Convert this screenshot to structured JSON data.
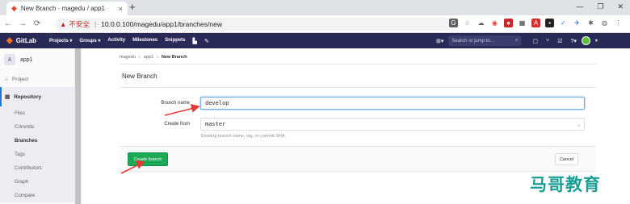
{
  "browser": {
    "tab_title": "New Branch · magedu / app1",
    "tab_close": "×",
    "new_tab": "+",
    "win_controls": [
      "—",
      "❐",
      "✕"
    ],
    "nav": [
      "←",
      "→",
      "⟳"
    ],
    "security_label": "不安全",
    "separator": "|",
    "url": "10.0.0.100/magedu/app1/branches/new"
  },
  "header": {
    "app_name": "GitLab",
    "nav": [
      {
        "label": "Projects ▾"
      },
      {
        "label": "Groups ▾"
      },
      {
        "label": "Activity"
      },
      {
        "label": "Milestones"
      },
      {
        "label": "Snippets"
      }
    ],
    "search_placeholder": "Search or jump to…",
    "search_icon": "⌕"
  },
  "sidebar": {
    "project_initial": "A",
    "project_name": "app1",
    "project_link": "Project",
    "repository_label": "Repository",
    "sub_items": [
      {
        "label": "Files"
      },
      {
        "label": "Commits"
      },
      {
        "label": "Branches"
      },
      {
        "label": "Tags"
      },
      {
        "label": "Contributors"
      },
      {
        "label": "Graph"
      },
      {
        "label": "Compare"
      }
    ]
  },
  "breadcrumb": {
    "items": [
      "magedu",
      "app1",
      "New Branch"
    ],
    "separator": "›"
  },
  "page": {
    "title": "New Branch"
  },
  "form": {
    "branch_name_label": "Branch name",
    "branch_name_value": "develop",
    "create_from_label": "Create from",
    "create_from_value": "master",
    "create_from_help": "Existing branch name, tag, or commit SHA",
    "chevron": "⌄"
  },
  "actions": {
    "create_label": "Create branch",
    "cancel_label": "Cancel"
  },
  "watermark": "马哥教育",
  "colors": {
    "header_bg": "#2a2a58",
    "create_btn": "#1aaa55",
    "annotation_arrow": "#e53935",
    "watermark": "#1a9e93"
  }
}
